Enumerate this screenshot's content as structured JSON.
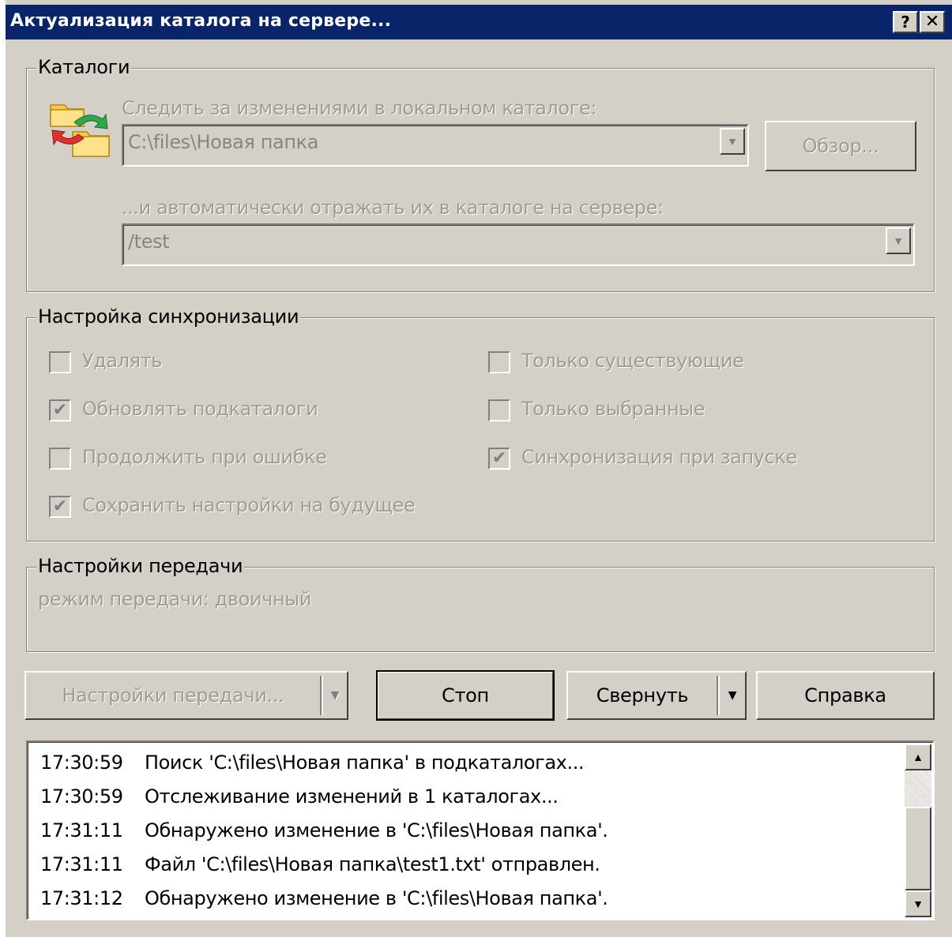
{
  "window": {
    "title": "Актуализация каталога на сервере...",
    "help_glyph": "?",
    "close_glyph": "✕"
  },
  "catalogs": {
    "group_label": "Каталоги",
    "local_label": "Следить за изменениями в локальном каталоге:",
    "local_value": "C:\\files\\Новая папка",
    "browse_label": "Обзор...",
    "server_label": "...и автоматически отражать их в каталоге на сервере:",
    "server_value": "/test"
  },
  "sync": {
    "group_label": "Настройка синхронизации",
    "options": [
      {
        "label": "Удалять",
        "checked": false
      },
      {
        "label": "Обновлять подкаталоги",
        "checked": true
      },
      {
        "label": "Продолжить при ошибке",
        "checked": false
      },
      {
        "label": "Сохранить настройки на будущее",
        "checked": true
      },
      {
        "label": "Только существующие",
        "checked": false
      },
      {
        "label": "Только выбранные",
        "checked": false
      },
      {
        "label": "Синхронизация при запуске",
        "checked": true
      }
    ]
  },
  "transfer": {
    "group_label": "Настройки передачи",
    "mode_text": "режим передачи: двоичный"
  },
  "buttons": {
    "transfer_settings": "Настройки передачи...",
    "stop": "Стоп",
    "minimize": "Свернуть",
    "help": "Справка"
  },
  "log": [
    {
      "time": "17:30:59",
      "message": "Поиск 'C:\\files\\Новая папка' в подкаталогах..."
    },
    {
      "time": "17:30:59",
      "message": "Отслеживание изменений в 1 каталогах..."
    },
    {
      "time": "17:31:11",
      "message": "Обнаружено изменение в 'C:\\files\\Новая папка'."
    },
    {
      "time": "17:31:11",
      "message": "Файл 'C:\\files\\Новая папка\\test1.txt' отправлен."
    },
    {
      "time": "17:31:12",
      "message": "Обнаружено изменение в 'C:\\files\\Новая папка'."
    }
  ],
  "icons": {
    "folder_sync": "folder-sync-icon",
    "dropdown": "▼",
    "scroll_up": "▲",
    "scroll_down": "▼",
    "check": "✔"
  },
  "colors": {
    "titlebar": "#0a246a",
    "face": "#d4d0c8",
    "disabled_text": "#a09c94"
  }
}
